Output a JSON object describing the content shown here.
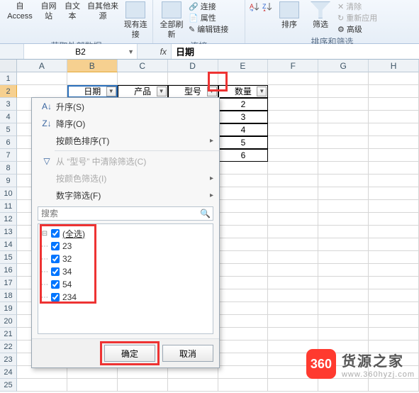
{
  "ribbon": {
    "groups": {
      "external_data": {
        "label": "获取外部数据",
        "items": {
          "access": "自 Access",
          "web": "自网站",
          "text": "自文本",
          "other": "自其他来源",
          "existing": "现有连接"
        }
      },
      "connections": {
        "label": "连接",
        "items": {
          "refresh": "全部刷新",
          "conn": "连接",
          "props": "属性",
          "edit": "编辑链接"
        }
      },
      "sort_filter": {
        "label": "排序和筛选",
        "items": {
          "az": "A→Z",
          "za": "Z→A",
          "sort": "排序",
          "filter": "筛选",
          "reapply": "重新应用",
          "advanced": "高级",
          "clear": "清除"
        }
      }
    }
  },
  "namebox": {
    "value": "B2"
  },
  "formula_bar": {
    "value": "日期"
  },
  "columns": [
    "A",
    "B",
    "C",
    "D",
    "E",
    "F",
    "G",
    "H"
  ],
  "rows": [
    1,
    2,
    3,
    4,
    5,
    6,
    7,
    8,
    9,
    10,
    11,
    12,
    13,
    14,
    15,
    16,
    17,
    18,
    19,
    20,
    21,
    22,
    23,
    24,
    25
  ],
  "table": {
    "headers": [
      "日期",
      "产品",
      "型号",
      "数量"
    ],
    "data_e": [
      "2",
      "3",
      "4",
      "5",
      "6"
    ]
  },
  "filter_menu": {
    "sort_asc": "升序(S)",
    "sort_desc": "降序(O)",
    "sort_color": "按颜色排序(T)",
    "clear": "从 “型号” 中清除筛选(C)",
    "filter_color": "按颜色筛选(I)",
    "filter_num": "数字筛选(F)",
    "search_placeholder": "搜索",
    "items": [
      "(全选)",
      "23",
      "32",
      "34",
      "54",
      "234"
    ],
    "ok": "确定",
    "cancel": "取消"
  },
  "watermark": {
    "badge": "360",
    "title": "货源之家",
    "url": "www.360hyzj.com"
  },
  "icons": {
    "dropdown": "▼",
    "play": "▸",
    "magnifier": "🔍"
  }
}
